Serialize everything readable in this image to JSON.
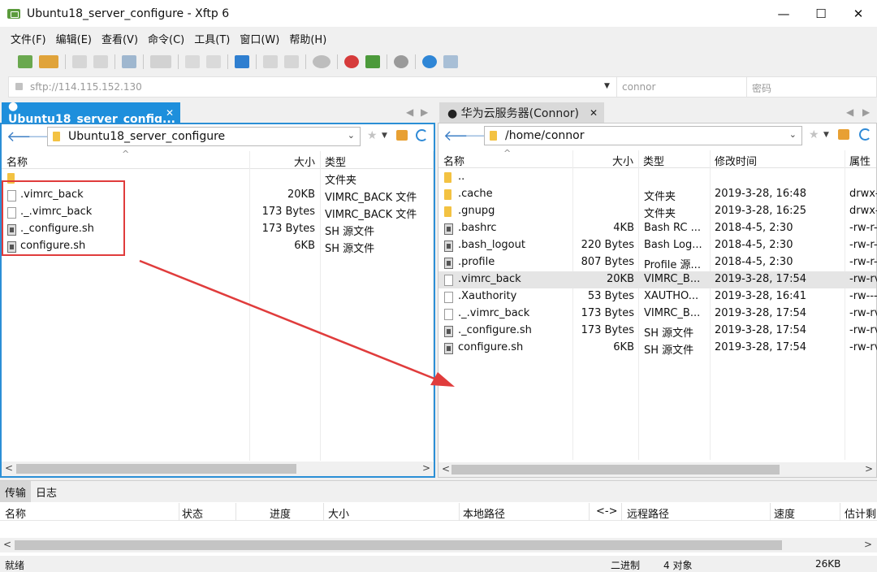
{
  "window": {
    "title": "Ubuntu18_server_configure - Xftp 6",
    "minimize": "—",
    "maximize": "☐",
    "close": "✕"
  },
  "menu": [
    "文件(F)",
    "编辑(E)",
    "查看(V)",
    "命令(C)",
    "工具(T)",
    "窗口(W)",
    "帮助(H)"
  ],
  "address": {
    "url": "sftp://114.115.152.130",
    "username_placeholder": "connor",
    "password_placeholder": "密码"
  },
  "left": {
    "tab_label": "● Ubuntu18_server_config...",
    "path": "Ubuntu18_server_configure",
    "columns": [
      "名称",
      "大小",
      "类型"
    ],
    "rows": [
      {
        "name": "",
        "size": "",
        "type": "文件夹",
        "icon": "folder-icon"
      },
      {
        "name": ".vimrc_back",
        "size": "20KB",
        "type": "VIMRC_BACK 文件",
        "icon": "file-icon"
      },
      {
        "name": "._.vimrc_back",
        "size": "173 Bytes",
        "type": "VIMRC_BACK 文件",
        "icon": "file-icon"
      },
      {
        "name": "._configure.sh",
        "size": "173 Bytes",
        "type": "SH 源文件",
        "icon": "script-icon"
      },
      {
        "name": "configure.sh",
        "size": "6KB",
        "type": "SH 源文件",
        "icon": "script-icon"
      }
    ]
  },
  "right": {
    "tab_label": "● 华为云服务器(Connor)",
    "path": "/home/connor",
    "columns": [
      "名称",
      "大小",
      "类型",
      "修改时间",
      "属性"
    ],
    "rows": [
      {
        "name": "..",
        "size": "",
        "type": "",
        "modified": "",
        "attr": "",
        "icon": "folder-icon"
      },
      {
        "name": ".cache",
        "size": "",
        "type": "文件夹",
        "modified": "2019-3-28, 16:48",
        "attr": "drwx-",
        "icon": "folder-icon"
      },
      {
        "name": ".gnupg",
        "size": "",
        "type": "文件夹",
        "modified": "2019-3-28, 16:25",
        "attr": "drwx-",
        "icon": "folder-icon"
      },
      {
        "name": ".bashrc",
        "size": "4KB",
        "type": "Bash RC ...",
        "modified": "2018-4-5, 2:30",
        "attr": "-rw-r-",
        "icon": "script-icon"
      },
      {
        "name": ".bash_logout",
        "size": "220 Bytes",
        "type": "Bash Log...",
        "modified": "2018-4-5, 2:30",
        "attr": "-rw-r-",
        "icon": "script-icon"
      },
      {
        "name": ".profile",
        "size": "807 Bytes",
        "type": "Profile 源...",
        "modified": "2018-4-5, 2:30",
        "attr": "-rw-r-",
        "icon": "script-icon"
      },
      {
        "name": ".vimrc_back",
        "size": "20KB",
        "type": "VIMRC_B...",
        "modified": "2019-3-28, 17:54",
        "attr": "-rw-rv",
        "icon": "file-icon",
        "selected": true
      },
      {
        "name": ".Xauthority",
        "size": "53 Bytes",
        "type": "XAUTHO...",
        "modified": "2019-3-28, 16:41",
        "attr": "-rw---",
        "icon": "file-icon"
      },
      {
        "name": "._.vimrc_back",
        "size": "173 Bytes",
        "type": "VIMRC_B...",
        "modified": "2019-3-28, 17:54",
        "attr": "-rw-rv",
        "icon": "file-icon"
      },
      {
        "name": "._configure.sh",
        "size": "173 Bytes",
        "type": "SH 源文件",
        "modified": "2019-3-28, 17:54",
        "attr": "-rw-rv",
        "icon": "script-icon"
      },
      {
        "name": "configure.sh",
        "size": "6KB",
        "type": "SH 源文件",
        "modified": "2019-3-28, 17:54",
        "attr": "-rw-rv",
        "icon": "script-icon"
      }
    ]
  },
  "transfer": {
    "tabs": [
      "传输",
      "日志"
    ],
    "columns": [
      "名称",
      "状态",
      "进度",
      "大小",
      "本地路径",
      "<->",
      "远程路径",
      "速度",
      "估计剩"
    ]
  },
  "status": {
    "left": "就绪",
    "mode": "二进制",
    "count": "4 对象",
    "size": "26KB"
  },
  "colors": {
    "accent": "#1e8fdc",
    "annotation": "#e03c3c"
  }
}
